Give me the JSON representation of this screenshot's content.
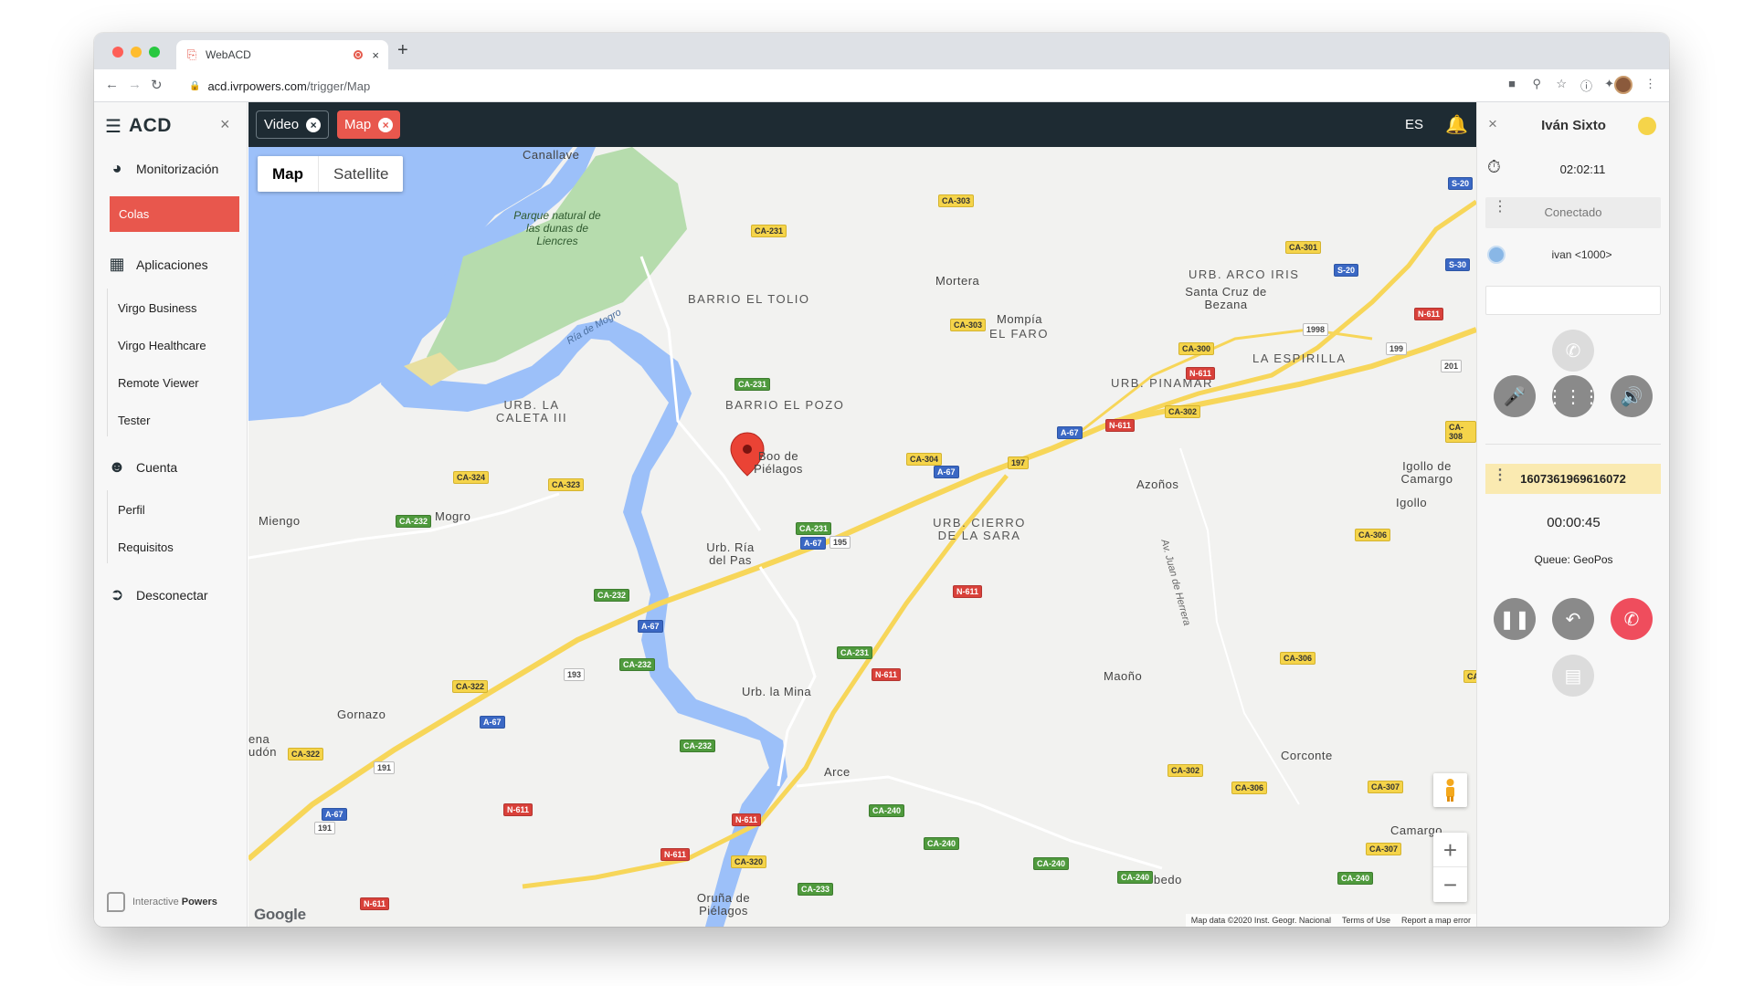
{
  "browser": {
    "tab_title": "WebACD",
    "url_host": "acd.ivrpowers.com",
    "url_path": "/trigger/Map",
    "new_tab_label": "+",
    "tab_close_label": "×"
  },
  "sidebar": {
    "brand": "ACD",
    "close_label": "×",
    "sections": [
      {
        "label": "Monitorización",
        "icon": "dashboard-gauge-icon"
      },
      {
        "label": "Aplicaciones",
        "icon": "grid-icon"
      },
      {
        "label": "Cuenta",
        "icon": "user-icon"
      },
      {
        "label": "Desconectar",
        "icon": "logout-icon"
      }
    ],
    "monitorizacion_items": [
      "Colas"
    ],
    "aplicaciones_items": [
      "Virgo Business",
      "Virgo Healthcare",
      "Remote Viewer",
      "Tester"
    ],
    "cuenta_items": [
      "Perfil",
      "Requisitos"
    ],
    "footer": {
      "prefix": "Interactive",
      "bold": "Powers"
    }
  },
  "topbar": {
    "tabs": [
      {
        "label": "Video"
      },
      {
        "label": "Map"
      }
    ],
    "active_tab": "Map",
    "language": "ES",
    "accent_color": "#e8574d",
    "bar_color": "#1e2b33"
  },
  "map": {
    "type_options": [
      "Map",
      "Satellite"
    ],
    "selected_type": "Map",
    "labels": {
      "canallave": "Canallave",
      "parque": "Parque natural de las dunas de Liencres",
      "ria": "Ría de Mogro",
      "barrio_tolio": "BARRIO EL TOLIO",
      "mortera": "Mortera",
      "mompia": "Mompía",
      "el_faro": "EL FARO",
      "arco_iris": "URB. ARCO IRIS",
      "santa_cruz": "Santa Cruz de Bezana",
      "la_espirilla": "LA ESPIRILLA",
      "pinamar": "URB. PINAMAR",
      "caleta": "URB. LA CALETA III",
      "barrio_pozo": "BARRIO EL POZO",
      "boo": "Boo de Piélagos",
      "miengo": "Miengo",
      "mogro": "Mogro",
      "ria_pas": "Urb. Ría del Pas",
      "cierro": "URB. CIERRO DE LA SARA",
      "azonos": "Azoños",
      "igollo_camargo": "Igollo de Camargo",
      "igollo": "Igollo",
      "juan_herrera": "Av. Juan de Herrera",
      "gornazo": "Gornazo",
      "urb_mina": "Urb. la Mina",
      "maono": "Maoño",
      "arce": "Arce",
      "corconte": "Corconte",
      "camargo": "Camargo",
      "escobedo": "Escobedo",
      "orunia": "Oruña de Piélagos",
      "edge_left": "ena udón"
    },
    "road_shields": [
      "CA-231",
      "CA-303",
      "CA-301",
      "S-20",
      "S-20",
      "S-30",
      "N-611",
      "CA-303",
      "CA-300",
      "N-611",
      "CA-231",
      "CA-302",
      "N-611",
      "A-67",
      "CA-308",
      "CA-324",
      "CA-323",
      "CA-232",
      "CA-304",
      "A-67",
      "197",
      "CA-231",
      "A-67",
      "195",
      "CA-232",
      "A-67",
      "N-611",
      "CA-306",
      "CA-231",
      "CA-322",
      "193",
      "CA-232",
      "N-611",
      "A-67",
      "CA-322",
      "191",
      "CA-232",
      "N-611",
      "A-67",
      "191",
      "N-611",
      "CA-240",
      "CA-240",
      "CA-240",
      "CA-240",
      "N-611",
      "CA-320",
      "CA-233",
      "N-611",
      "CA-302",
      "CA-306",
      "CA-307",
      "CA-307",
      "CA-240",
      "CA-306",
      "1998",
      "199",
      "201",
      "CA"
    ],
    "google_label": "Google",
    "attribution": [
      "Map data ©2020 Inst. Geogr. Nacional",
      "Terms of Use",
      "Report a map error"
    ],
    "zoom_in": "+",
    "zoom_out": "−",
    "water_color": "#9cc0f9",
    "park_color": "#b6dcad",
    "road_color": "#f7d659"
  },
  "phone": {
    "close_label": "×",
    "agent_name": "Iván Sixto",
    "presence_color": "#f5d44a",
    "session_time": "02:02:11",
    "status": "Conectado",
    "extension": "ivan <1000>",
    "dial_input_value": "",
    "call_number": "1607361969616072",
    "call_duration": "00:00:45",
    "queue": "Queue: GeoPos",
    "hangup_color": "#ef4d5d"
  }
}
